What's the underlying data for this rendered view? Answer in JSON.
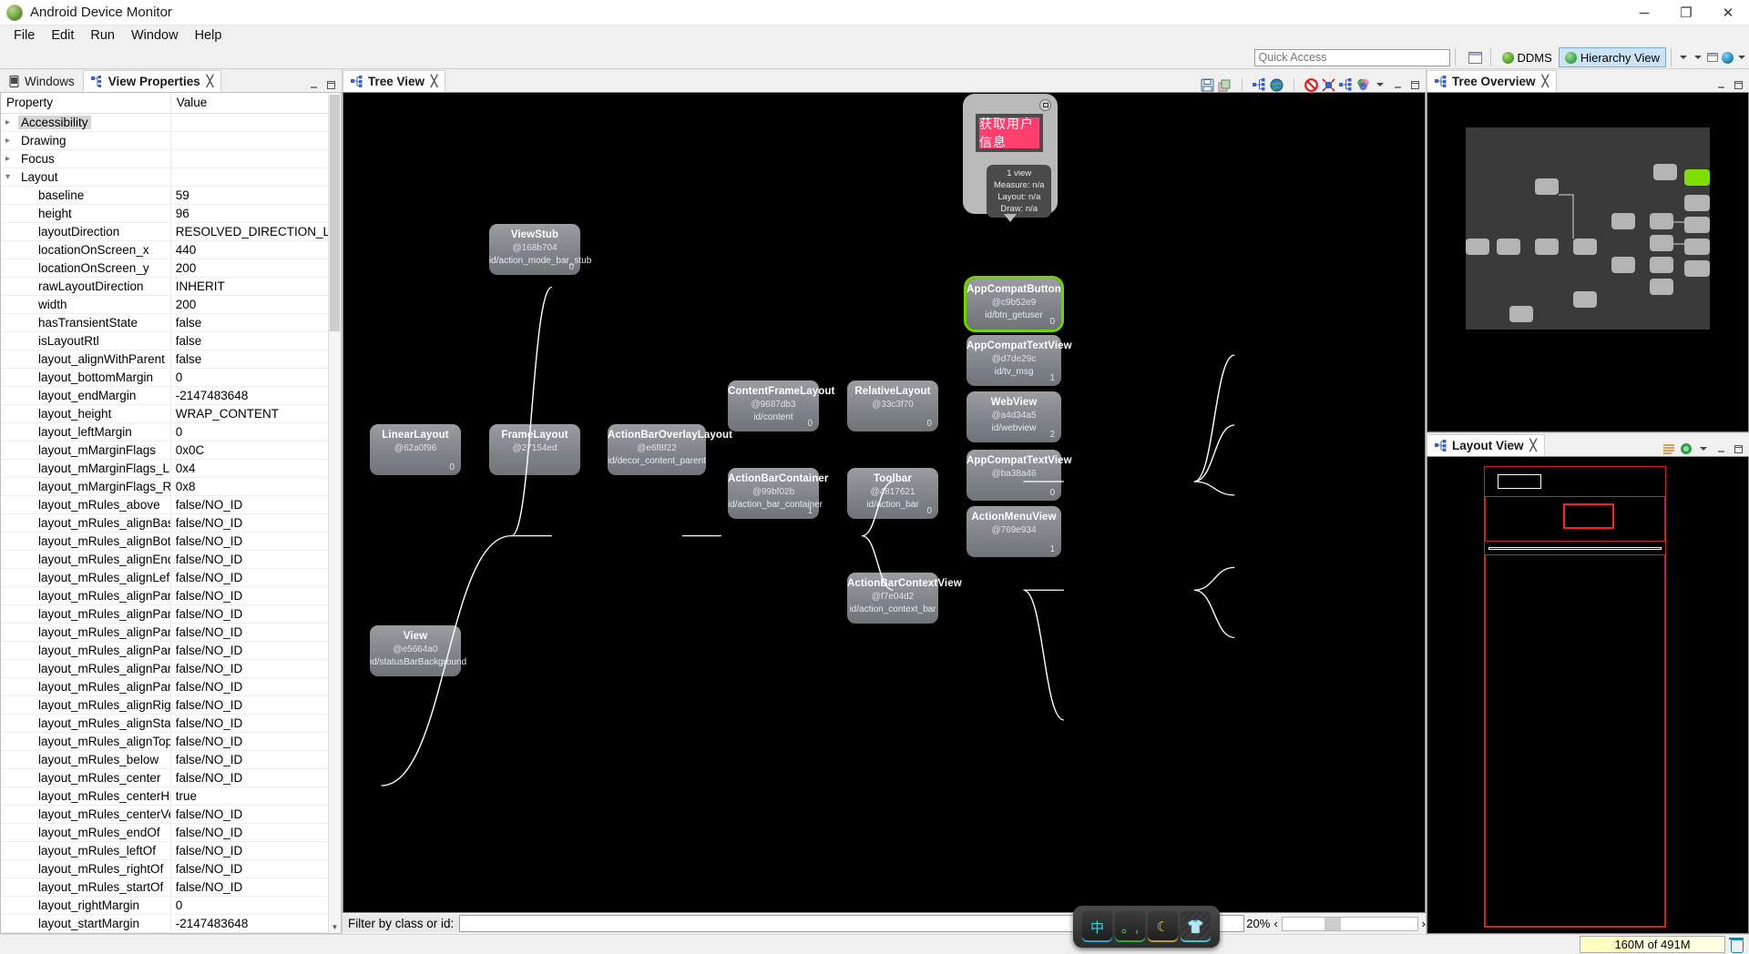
{
  "window": {
    "title": "Android Device Monitor",
    "app_icon": "android-icon",
    "minimize": "─",
    "maximize": "❐",
    "close": "✕"
  },
  "menubar": [
    {
      "label": "File",
      "mnemonic": "F"
    },
    {
      "label": "Edit",
      "mnemonic": "E"
    },
    {
      "label": "Run",
      "mnemonic": "R"
    },
    {
      "label": "Window",
      "mnemonic": "W"
    },
    {
      "label": "Help",
      "mnemonic": "H"
    }
  ],
  "toolbar": {
    "quick_access_placeholder": "Quick Access",
    "perspectives": [
      {
        "label": "DDMS",
        "icon": "ddms-icon",
        "active": false
      },
      {
        "label": "Hierarchy View",
        "icon": "hierarchy-view-icon",
        "active": true
      }
    ],
    "open_perspective_icon": "open-perspective-icon"
  },
  "properties_view": {
    "tabs": [
      {
        "label": "Windows",
        "icon": "device-icon",
        "selected": false
      },
      {
        "label": "View Properties",
        "icon": "view-properties-icon",
        "selected": true
      }
    ],
    "columns": [
      "Property",
      "Value"
    ],
    "groups": [
      {
        "name": "Accessibility",
        "expanded": false,
        "highlighted": true
      },
      {
        "name": "Drawing",
        "expanded": false,
        "highlighted": false
      },
      {
        "name": "Focus",
        "expanded": false,
        "highlighted": false
      },
      {
        "name": "Layout",
        "expanded": true,
        "highlighted": false
      }
    ],
    "rows": [
      {
        "property": "baseline",
        "value": "59"
      },
      {
        "property": "height",
        "value": "96"
      },
      {
        "property": "layoutDirection",
        "value": "RESOLVED_DIRECTION_LTR"
      },
      {
        "property": "locationOnScreen_x",
        "value": "440"
      },
      {
        "property": "locationOnScreen_y",
        "value": "200"
      },
      {
        "property": "rawLayoutDirection",
        "value": "INHERIT"
      },
      {
        "property": "width",
        "value": "200"
      },
      {
        "property": "hasTransientState",
        "value": "false"
      },
      {
        "property": "isLayoutRtl",
        "value": "false"
      },
      {
        "property": "layout_alignWithParent",
        "value": "false"
      },
      {
        "property": "layout_bottomMargin",
        "value": "0"
      },
      {
        "property": "layout_endMargin",
        "value": "-2147483648"
      },
      {
        "property": "layout_height",
        "value": "WRAP_CONTENT"
      },
      {
        "property": "layout_leftMargin",
        "value": "0"
      },
      {
        "property": "layout_mMarginFlags",
        "value": "0x0C"
      },
      {
        "property": "layout_mMarginFlags_LEFT_MA",
        "value": "0x4"
      },
      {
        "property": "layout_mMarginFlags_RIGHT_M",
        "value": "0x8"
      },
      {
        "property": "layout_mRules_above",
        "value": "false/NO_ID"
      },
      {
        "property": "layout_mRules_alignBaseline",
        "value": "false/NO_ID"
      },
      {
        "property": "layout_mRules_alignBottom",
        "value": "false/NO_ID"
      },
      {
        "property": "layout_mRules_alignEnd",
        "value": "false/NO_ID"
      },
      {
        "property": "layout_mRules_alignLeft",
        "value": "false/NO_ID"
      },
      {
        "property": "layout_mRules_alignParentBott",
        "value": "false/NO_ID"
      },
      {
        "property": "layout_mRules_alignParentEnd",
        "value": "false/NO_ID"
      },
      {
        "property": "layout_mRules_alignParentLeft",
        "value": "false/NO_ID"
      },
      {
        "property": "layout_mRules_alignParentRigl",
        "value": "false/NO_ID"
      },
      {
        "property": "layout_mRules_alignParentStar",
        "value": "false/NO_ID"
      },
      {
        "property": "layout_mRules_alignParentTop",
        "value": "false/NO_ID"
      },
      {
        "property": "layout_mRules_alignRight",
        "value": "false/NO_ID"
      },
      {
        "property": "layout_mRules_alignStart",
        "value": "false/NO_ID"
      },
      {
        "property": "layout_mRules_alignTop",
        "value": "false/NO_ID"
      },
      {
        "property": "layout_mRules_below",
        "value": "false/NO_ID"
      },
      {
        "property": "layout_mRules_center",
        "value": "false/NO_ID"
      },
      {
        "property": "layout_mRules_centerHorizont",
        "value": "true"
      },
      {
        "property": "layout_mRules_centerVertical",
        "value": "false/NO_ID"
      },
      {
        "property": "layout_mRules_endOf",
        "value": "false/NO_ID"
      },
      {
        "property": "layout_mRules_leftOf",
        "value": "false/NO_ID"
      },
      {
        "property": "layout_mRules_rightOf",
        "value": "false/NO_ID"
      },
      {
        "property": "layout_mRules_startOf",
        "value": "false/NO_ID"
      },
      {
        "property": "layout_rightMargin",
        "value": "0"
      },
      {
        "property": "layout_startMargin",
        "value": "-2147483648"
      }
    ]
  },
  "tree_view": {
    "tab_label": "Tree View",
    "tab_icon": "tree-view-icon",
    "toolbar_icons": [
      "save-icon",
      "layers-icon",
      "tree-icon",
      "globe-icon",
      "invalidate-icon",
      "request-layout-icon",
      "dump-tree-icon",
      "profile-icon"
    ],
    "view_menu_icon": "view-menu-icon",
    "minimize_icon": "minimize-icon",
    "maximize_icon": "maximize-icon",
    "filter_label": "Filter by class or id:",
    "filter_value": "",
    "zoom_label": "20%",
    "zoom_decrease": "‹",
    "zoom_increase": "›",
    "nodes": [
      {
        "class": "LinearLayout",
        "hash": "@62a0f96",
        "id": "",
        "index": "0"
      },
      {
        "class": "ViewStub",
        "hash": "@168b704",
        "id": "id/action_mode_bar_stub",
        "index": "0"
      },
      {
        "class": "FrameLayout",
        "hash": "@27154ed",
        "id": "",
        "index": ""
      },
      {
        "class": "View",
        "hash": "@e5664a0",
        "id": "id/statusBarBackground",
        "index": ""
      },
      {
        "class": "ActionBarOverlayLayout",
        "hash": "@e6f8f22",
        "id": "id/decor_content_parent",
        "index": ""
      },
      {
        "class": "ContentFrameLayout",
        "hash": "@9687db3",
        "id": "id/content",
        "index": "0"
      },
      {
        "class": "ActionBarContainer",
        "hash": "@99bf02b",
        "id": "id/action_bar_container",
        "index": "1"
      },
      {
        "class": "RelativeLayout",
        "hash": "@33c3f70",
        "id": "",
        "index": "0"
      },
      {
        "class": "Toolbar",
        "hash": "@4817621",
        "id": "id/action_bar",
        "index": "0"
      },
      {
        "class": "ActionBarContextView",
        "hash": "@f7e04d2",
        "id": "id/action_context_bar",
        "index": ""
      },
      {
        "class": "AppCompatButton",
        "hash": "@c9b52e9",
        "id": "id/btn_getuser",
        "index": "0",
        "selected": true
      },
      {
        "class": "AppCompatTextView",
        "hash": "@d7de29c",
        "id": "id/tv_msg",
        "index": "1"
      },
      {
        "class": "WebView",
        "hash": "@a4d34a5",
        "id": "id/webview",
        "index": "2"
      },
      {
        "class": "AppCompatTextView",
        "hash": "@ba38a46",
        "id": "",
        "index": "0"
      },
      {
        "class": "ActionMenuView",
        "hash": "@769e934",
        "id": "",
        "index": "1"
      }
    ],
    "preview": {
      "button_text": "获取用户信息",
      "button_color": "#ff3f6e",
      "stats": [
        "1 view",
        "Measure: n/a",
        "Layout: n/a",
        "Draw: n/a"
      ],
      "corner_icon": "capture-icon"
    }
  },
  "tree_overview": {
    "tab_label": "Tree Overview",
    "tab_icon": "tree-overview-icon",
    "minimize_icon": "minimize-icon",
    "maximize_icon": "maximize-icon",
    "selected_node_color": "#7ede00"
  },
  "layout_view": {
    "tab_label": "Layout View",
    "tab_icon": "layout-view-icon",
    "toolbar_icons": [
      "show-extras-icon",
      "load-overlay-icon"
    ],
    "view_menu_icon": "view-menu-icon",
    "minimize_icon": "minimize-icon",
    "maximize_icon": "maximize-icon",
    "selection_color": "#ff2020"
  },
  "statusbar": {
    "heap_text": "160M of 491M",
    "heap_percent": 33,
    "trash_icon": "trash-icon"
  },
  "ime_toolbar": {
    "keys": [
      {
        "glyph": "中",
        "name": "ime-chinese-mode"
      },
      {
        "glyph": "。,",
        "name": "ime-punctuation-mode"
      },
      {
        "glyph": "☾",
        "name": "ime-night-mode"
      },
      {
        "glyph": "👕",
        "name": "ime-skin-button"
      }
    ]
  }
}
